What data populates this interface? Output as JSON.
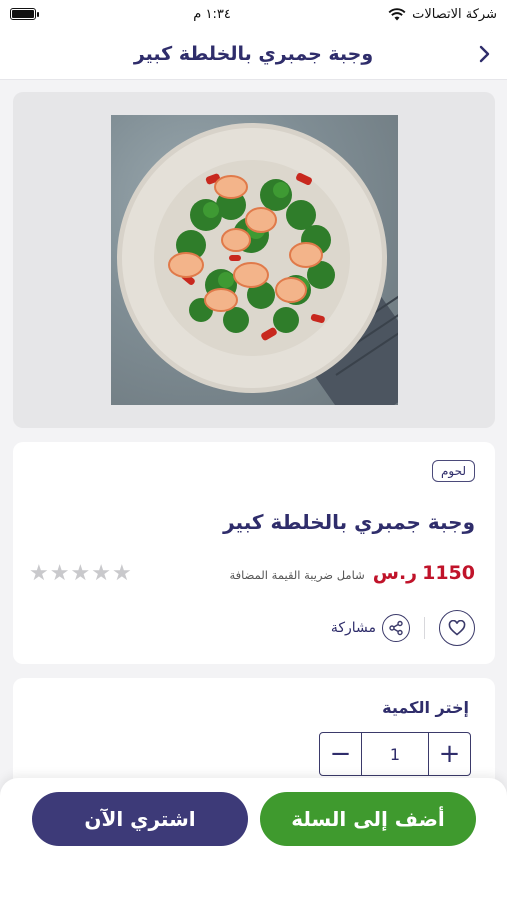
{
  "status_bar": {
    "carrier": "شركة الاتصالات",
    "time": "١:٣٤ م",
    "battery_level": 1.0
  },
  "header": {
    "title": "وجبة جمبري بالخلطة كبير",
    "back_icon": "chevron-right-icon"
  },
  "product": {
    "category": "لحوم",
    "name": "وجبة جمبري بالخلطة كبير",
    "price": "1150",
    "currency": "ر.س",
    "vat_note": "شامل ضريبة القيمة المضافة",
    "rating": 0,
    "rating_max": 5,
    "share_label": "مشاركة"
  },
  "quantity": {
    "title": "إختر الكمية",
    "value": "1",
    "plus": "+",
    "minus": "−"
  },
  "actions": {
    "add_to_cart": "أضف إلى السلة",
    "buy_now": "اشتري الآن"
  },
  "colors": {
    "primary": "#2f2d6b",
    "price": "#c0132a",
    "cart_button": "#3f9a2e",
    "buy_button": "#3d3a78"
  }
}
